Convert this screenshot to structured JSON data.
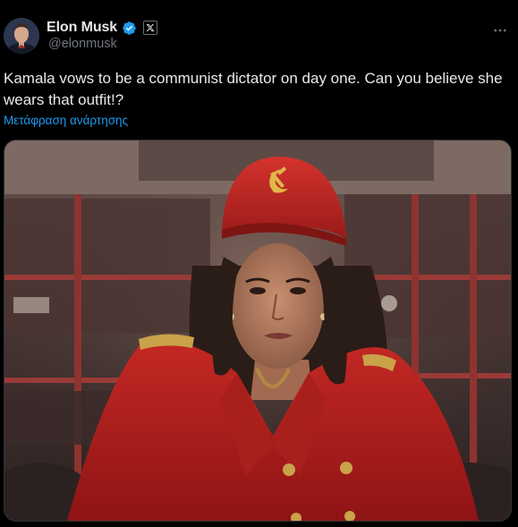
{
  "author": {
    "display_name": "Elon Musk",
    "handle": "@elonmusk",
    "verified": true,
    "affiliate_badge": "X",
    "avatar_icon": "user-avatar-photo"
  },
  "tweet": {
    "text": "Kamala vows to be a communist dictator on day one. Can you believe she wears that outfit!?",
    "translate_label": "Μετάφραση ανάρτησης"
  },
  "media": {
    "description_icon": "attached-photo"
  },
  "colors": {
    "background": "#000000",
    "text": "#e7e9ea",
    "secondary": "#71767b",
    "link": "#1d9bf0",
    "verified": "#1d9bf0"
  }
}
